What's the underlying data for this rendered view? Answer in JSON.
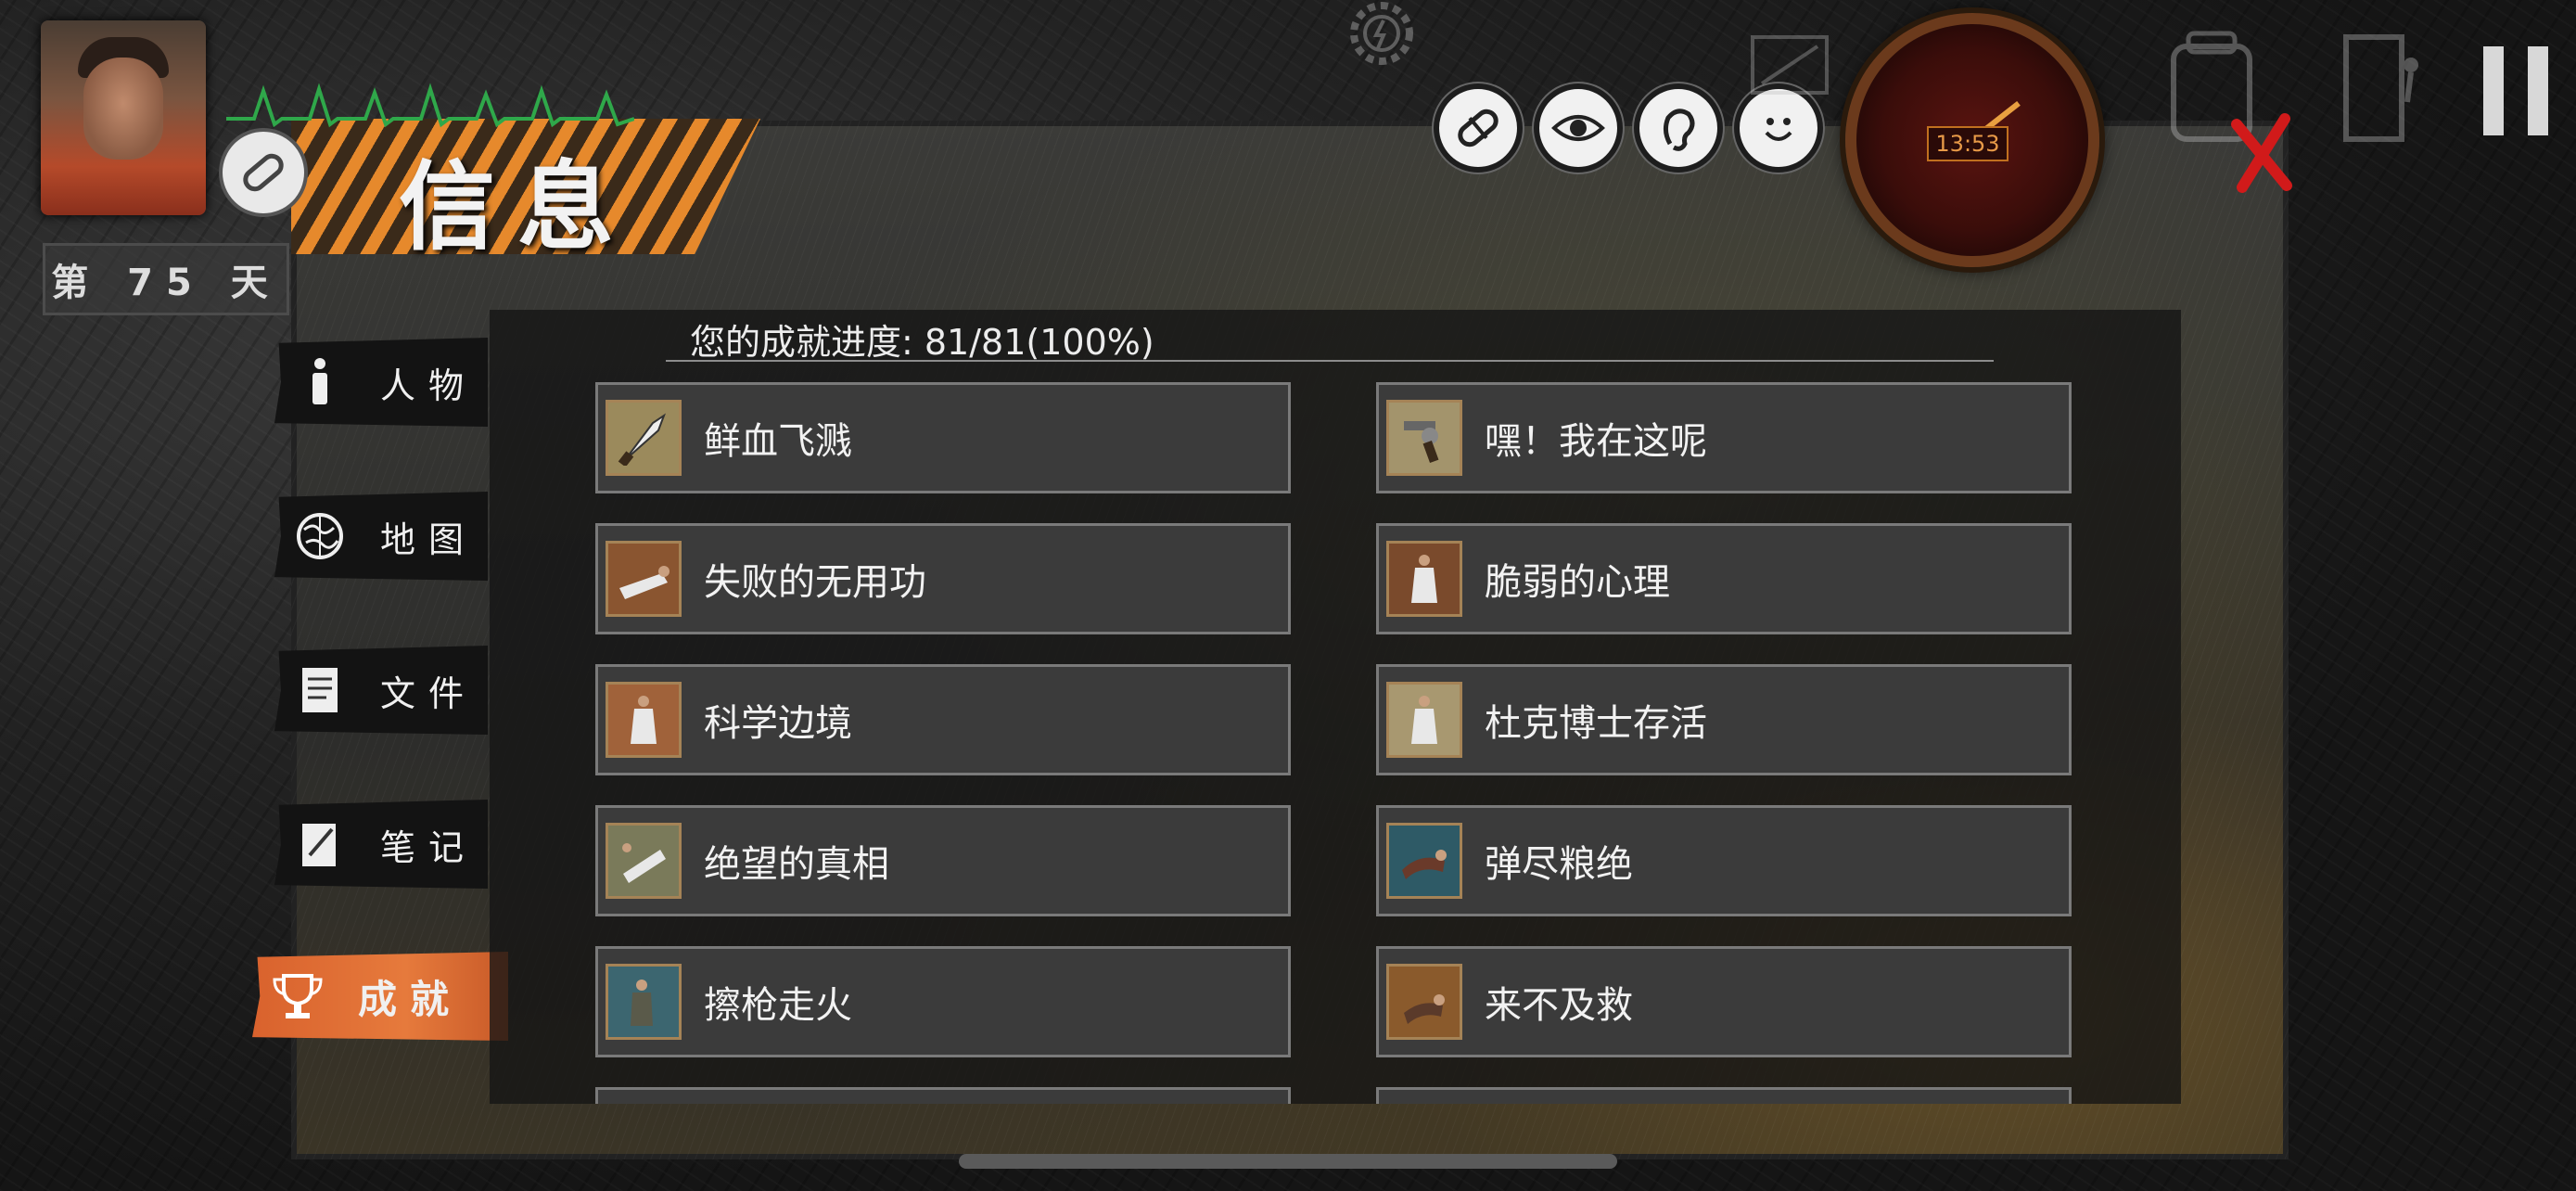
{
  "hud": {
    "day_label": "第 75 天",
    "clock_time": "13:53"
  },
  "window": {
    "title": "信息",
    "progress_text": "您的成就进度: 81/81(100%)"
  },
  "tabs": [
    {
      "label": "人物",
      "icon": "person-icon"
    },
    {
      "label": "地图",
      "icon": "globe-icon"
    },
    {
      "label": "文件",
      "icon": "document-icon"
    },
    {
      "label": "笔记",
      "icon": "notebook-icon"
    },
    {
      "label": "成就",
      "icon": "trophy-icon",
      "active": true
    }
  ],
  "top_icons": [
    "pill-icon",
    "eye-icon",
    "ear-icon",
    "smile-icon"
  ],
  "achievements": [
    {
      "name": "鲜血飞溅",
      "icon": "knife-icon",
      "color": "#9b8a5c"
    },
    {
      "name": "嘿！我在这呢",
      "icon": "revolver-icon",
      "color": "#a3946c"
    },
    {
      "name": "失败的无用功",
      "icon": "fallen-scientist-icon",
      "color": "#8a5530"
    },
    {
      "name": "脆弱的心理",
      "icon": "scientist-icon",
      "color": "#7a4a2c"
    },
    {
      "name": "科学边境",
      "icon": "scientist-standing-icon",
      "color": "#a0623a"
    },
    {
      "name": "杜克博士存活",
      "icon": "doctor-icon",
      "color": "#a89870"
    },
    {
      "name": "绝望的真相",
      "icon": "body-icon",
      "color": "#7a7a5a"
    },
    {
      "name": "弹尽粮绝",
      "icon": "crawling-man-icon",
      "color": "#2e5a66"
    },
    {
      "name": "擦枪走火",
      "icon": "soldier-icon",
      "color": "#3c6670"
    },
    {
      "name": "来不及救",
      "icon": "wounded-man-icon",
      "color": "#8a5a2c"
    }
  ],
  "colors": {
    "accent": "#e67a3c",
    "panel": "#3b3b3b",
    "clock_face": "#5a1410"
  }
}
